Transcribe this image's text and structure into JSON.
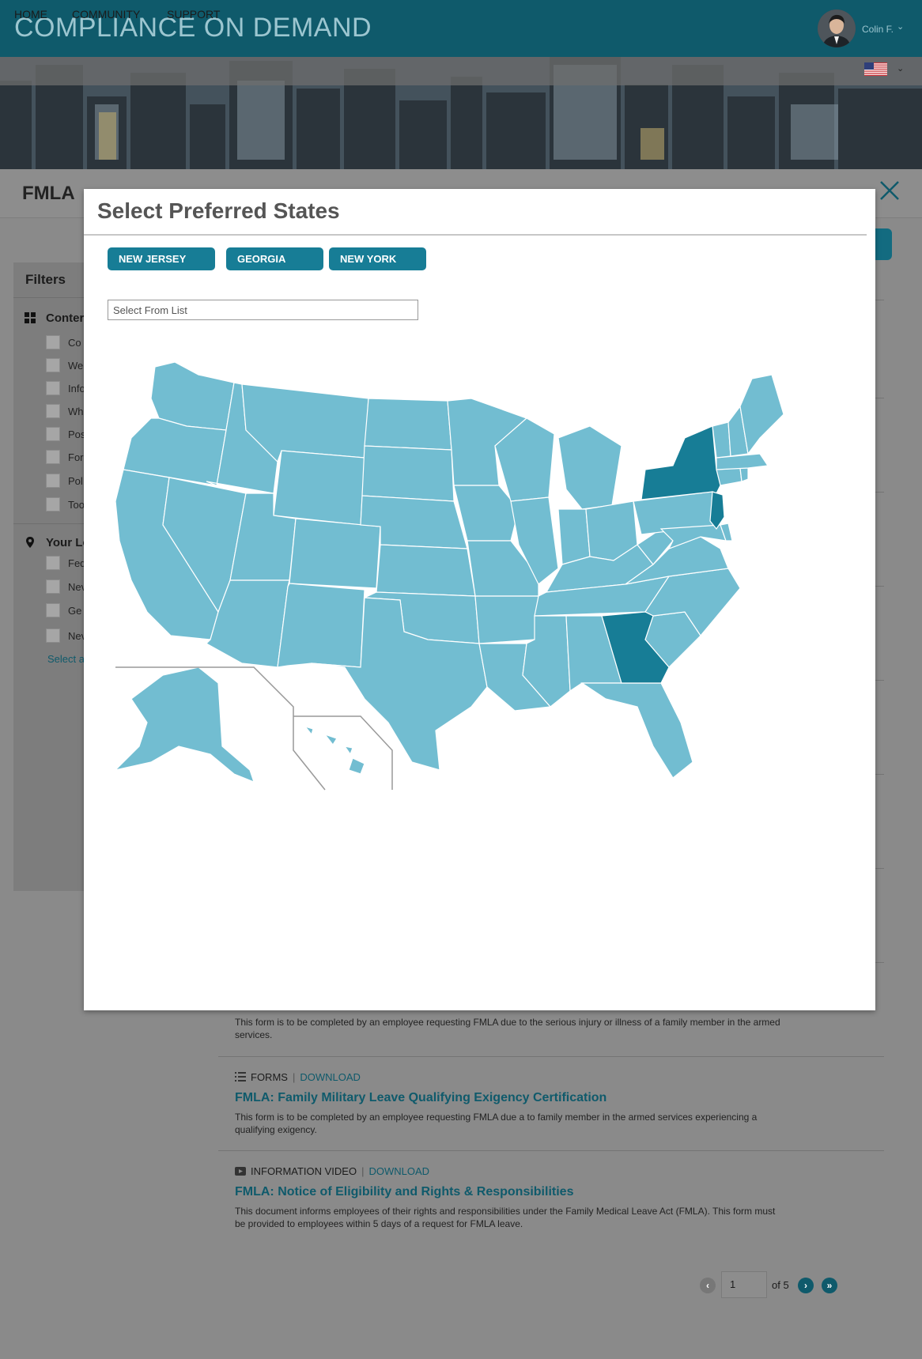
{
  "header": {
    "brand": "COMPLIANCE ON DEMAND",
    "user_name": "Colin F.",
    "nav": [
      "HOME",
      "COMMUNITY",
      "SUPPORT"
    ]
  },
  "page": {
    "title": "FMLA",
    "filters": {
      "title": "Filters",
      "content_section": "Conter",
      "content_items": [
        "Co",
        "We",
        "Info",
        "Wh",
        "Pos",
        "For",
        "Pol",
        "Too"
      ],
      "location_section": "Your Lo",
      "location_items": [
        "Fed",
        "Nev",
        "Ge",
        "Nev"
      ],
      "select_all": "Select a"
    },
    "items": [
      {
        "desc": "This form is to be completed by an employee requesting FMLA due to the serious injury or illness of a family member in the armed services."
      },
      {
        "type": "FORMS",
        "download": "DOWNLOAD",
        "title": " FMLA: Family Military Leave Qualifying Exigency Certification",
        "desc": "This form is to be completed by an employee requesting FMLA due a to family member in the armed services experiencing a qualifying exigency."
      },
      {
        "type": "INFORMATION VIDEO",
        "download": "DOWNLOAD",
        "title": "FMLA: Notice of Eligibility and Rights & Responsibilities",
        "desc": "This document informs employees of their rights and responsibilities under the Family Medical Leave Act (FMLA). This form must be provided to employees within 5 days of a request for FMLA leave."
      }
    ],
    "pager": {
      "current": "1",
      "of_label": "of 5"
    }
  },
  "modal": {
    "title": "Select Preferred States",
    "chips": [
      "NEW JERSEY",
      "GEORGIA",
      "NEW YORK"
    ],
    "select_placeholder": "Select From List",
    "map_colors": {
      "state": "#72bdd1",
      "selected": "#177d96",
      "border": "#ffffff"
    }
  }
}
